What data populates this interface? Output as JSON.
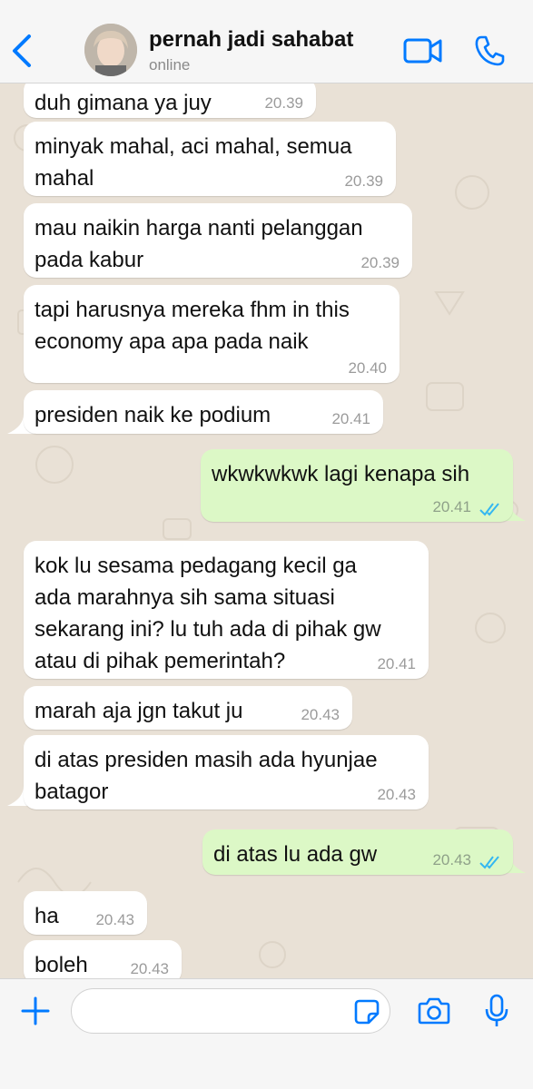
{
  "header": {
    "contact_name": "pernah jadi sahabat",
    "status": "online"
  },
  "colors": {
    "accent": "#007aff",
    "outgoing_bubble": "#dcf8c6",
    "incoming_bubble": "#ffffff",
    "chat_background": "#e9e1d6",
    "read_ticks": "#34b7f1"
  },
  "icons": {
    "back": "chevron-left-icon",
    "video": "video-camera-icon",
    "call": "phone-icon",
    "plus": "plus-icon",
    "sticker": "sticker-icon",
    "camera": "camera-icon",
    "mic": "microphone-icon",
    "read": "double-check-icon"
  },
  "messages": [
    {
      "direction": "in",
      "lines": [
        "duh gimana ya juy"
      ],
      "time": "20.39"
    },
    {
      "direction": "in",
      "lines": [
        "minyak mahal, aci mahal, semua",
        "mahal"
      ],
      "time": "20.39"
    },
    {
      "direction": "in",
      "lines": [
        "mau naikin harga nanti pelanggan",
        "pada kabur"
      ],
      "time": "20.39"
    },
    {
      "direction": "in",
      "lines": [
        "tapi harusnya mereka fhm in this",
        "economy apa apa pada naik"
      ],
      "time": "20.40"
    },
    {
      "direction": "in",
      "lines": [
        "presiden naik ke podium"
      ],
      "time": "20.41"
    },
    {
      "direction": "out",
      "lines": [
        "wkwkwkwk lagi kenapa sih"
      ],
      "time": "20.41",
      "status": "read"
    },
    {
      "direction": "in",
      "lines": [
        "kok lu sesama pedagang kecil ga",
        "ada marahnya sih sama situasi",
        "sekarang ini? lu tuh ada di pihak gw",
        "atau di pihak pemerintah?"
      ],
      "time": "20.41"
    },
    {
      "direction": "in",
      "lines": [
        "marah aja jgn takut ju"
      ],
      "time": "20.43"
    },
    {
      "direction": "in",
      "lines": [
        "di atas presiden masih ada hyunjae",
        "batagor"
      ],
      "time": "20.43"
    },
    {
      "direction": "out",
      "lines": [
        "di atas lu ada gw"
      ],
      "time": "20.43",
      "status": "read"
    },
    {
      "direction": "in",
      "lines": [
        "ha"
      ],
      "time": "20.43"
    },
    {
      "direction": "in",
      "lines": [
        "boleh"
      ],
      "time": "20.43"
    }
  ],
  "composer": {
    "value": "",
    "placeholder": ""
  }
}
